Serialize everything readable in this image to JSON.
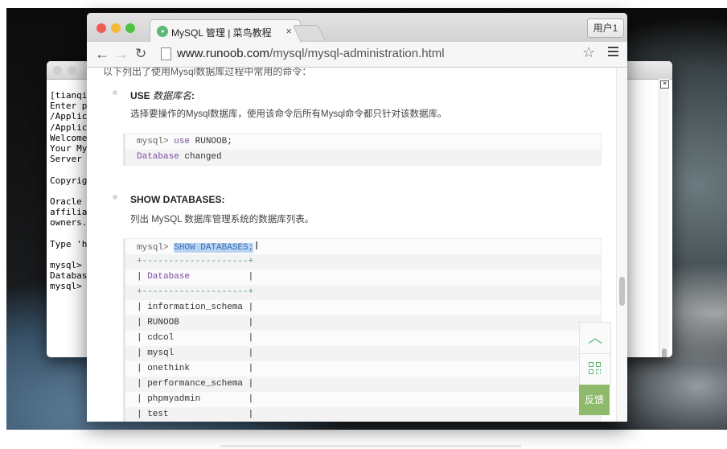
{
  "browser": {
    "tab_title": "MySQL 管理 | 菜鸟教程",
    "tab_close": "×",
    "user_button": "用户1",
    "url_host": "www.runoob.com",
    "url_path": "/mysql/mysql-administration.html"
  },
  "terminal": {
    "lines": [
      "[tianqix",
      "Enter p",
      "/Applic",
      "/Applic",
      "Welcome",
      "Your My",
      "Server ",
      "",
      "Copyrig",
      "",
      "Oracle ",
      "affilia",
      "owners.",
      "",
      "Type 'h",
      "",
      "mysql>",
      "Databas",
      "mysql>"
    ],
    "bracket": "]"
  },
  "page": {
    "cut_text": "以下列出了使用Mysql数据库过程中常用的命令：",
    "section1": {
      "head": "USE",
      "head_em": "数据库名",
      "head_colon": ":",
      "desc": "选择要操作的Mysql数据库，使用该命令后所有Mysql命令都只针对该数据库。",
      "code": {
        "prompt": "mysql>",
        "kw": "use",
        "rest": " RUNOOB;",
        "line2_kw": "Database",
        "line2_rest": " changed"
      }
    },
    "section2": {
      "head": "SHOW DATABASES:",
      "desc": "列出 MySQL 数据库管理系统的数据库列表。",
      "code": {
        "prompt": "mysql>",
        "command": "SHOW DATABASES;",
        "border": "+--------------------+",
        "header_left": "| ",
        "header": "Database",
        "header_right": "           |",
        "rows": [
          "| information_schema |",
          "| RUNOOB             |",
          "| cdcol              |",
          "| mysql              |",
          "| onethink           |",
          "| performance_schema |",
          "| phpmyadmin         |",
          "| test               |"
        ]
      }
    },
    "float_feedback": "反馈"
  },
  "colors": {
    "accent": "#5fb878",
    "feedback_bg": "#8dbb6b",
    "keyword": "#7a4ca3",
    "selection": "#b9d4f3"
  }
}
